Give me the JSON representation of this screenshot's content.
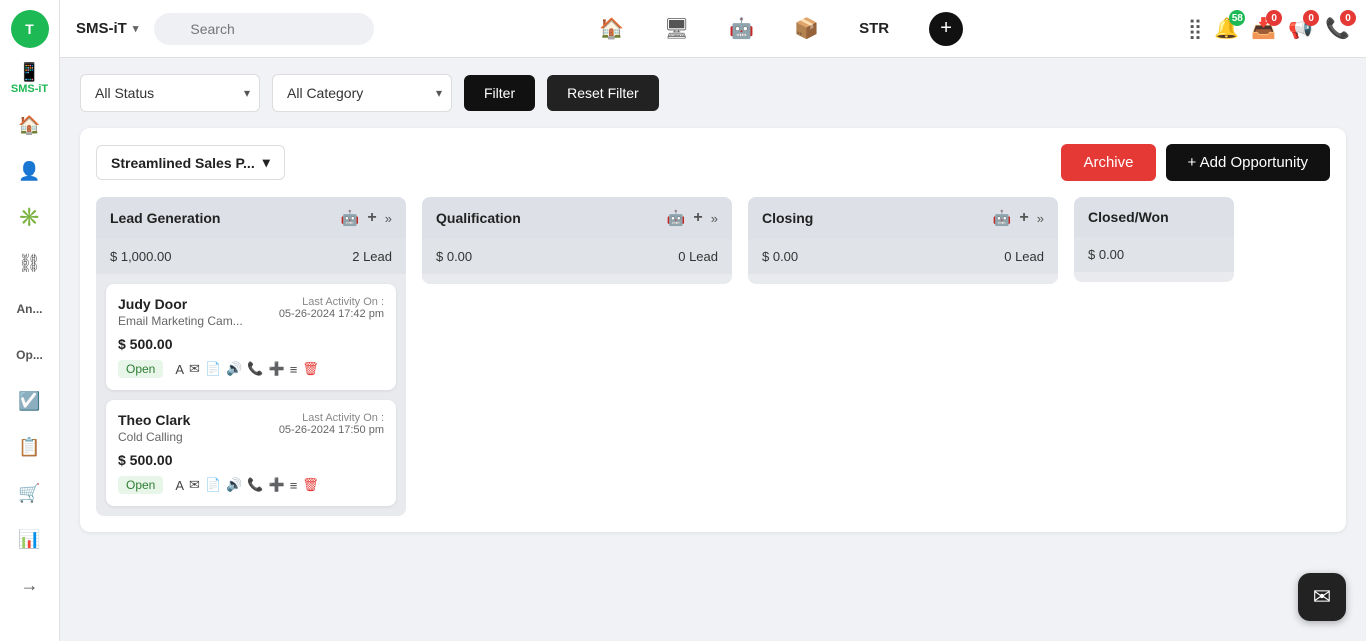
{
  "brand": {
    "name": "SMS-iT",
    "chevron": "▾"
  },
  "search": {
    "placeholder": "Search"
  },
  "topbar": {
    "str_label": "STR",
    "plus_label": "+",
    "icons": {
      "home": "🏠",
      "monitor": "🖥",
      "robot": "🤖",
      "box": "📦"
    }
  },
  "notifications": {
    "grid_icon": "⣿",
    "bell_count": "58",
    "inbox_count": "0",
    "megaphone_count": "0",
    "phone_count": "0"
  },
  "filters": {
    "status_label": "All Status",
    "category_label": "All Category",
    "filter_btn": "Filter",
    "reset_btn": "Reset Filter"
  },
  "pipeline": {
    "name": "Streamlined Sales P...",
    "archive_btn": "Archive",
    "add_btn": "+ Add Opportunity"
  },
  "columns": [
    {
      "title": "Lead Generation",
      "amount": "$ 1,000.00",
      "lead_count": "2 Lead",
      "cards": [
        {
          "name": "Judy Door",
          "sub": "Email Marketing Cam...",
          "last_activity_label": "Last Activity On :",
          "last_activity": "05-26-2024 17:42 pm",
          "amount": "$ 500.00",
          "status": "Open"
        },
        {
          "name": "Theo Clark",
          "sub": "Cold Calling",
          "last_activity_label": "Last Activity On :",
          "last_activity": "05-26-2024 17:50 pm",
          "amount": "$ 500.00",
          "status": "Open"
        }
      ]
    },
    {
      "title": "Qualification",
      "amount": "$ 0.00",
      "lead_count": "0 Lead",
      "cards": []
    },
    {
      "title": "Closing",
      "amount": "$ 0.00",
      "lead_count": "0 Lead",
      "cards": []
    },
    {
      "title": "Closed/Won",
      "amount": "$ 0.00",
      "lead_count": "",
      "cards": []
    }
  ],
  "sidebar": {
    "nav_items": [
      {
        "icon": "🏠",
        "name": "home"
      },
      {
        "icon": "👤",
        "name": "contacts"
      },
      {
        "icon": "✳",
        "name": "analytics"
      },
      {
        "icon": "⛓",
        "name": "pipeline-steps"
      },
      {
        "icon": "An",
        "name": "analytics2"
      },
      {
        "icon": "Op",
        "name": "opportunities"
      },
      {
        "icon": "☑",
        "name": "tasks"
      },
      {
        "icon": "📋",
        "name": "reports"
      },
      {
        "icon": "🛒",
        "name": "shop"
      },
      {
        "icon": "📊",
        "name": "dashboard"
      },
      {
        "icon": "→|",
        "name": "collapse"
      }
    ]
  },
  "chat_bubble": "✉"
}
